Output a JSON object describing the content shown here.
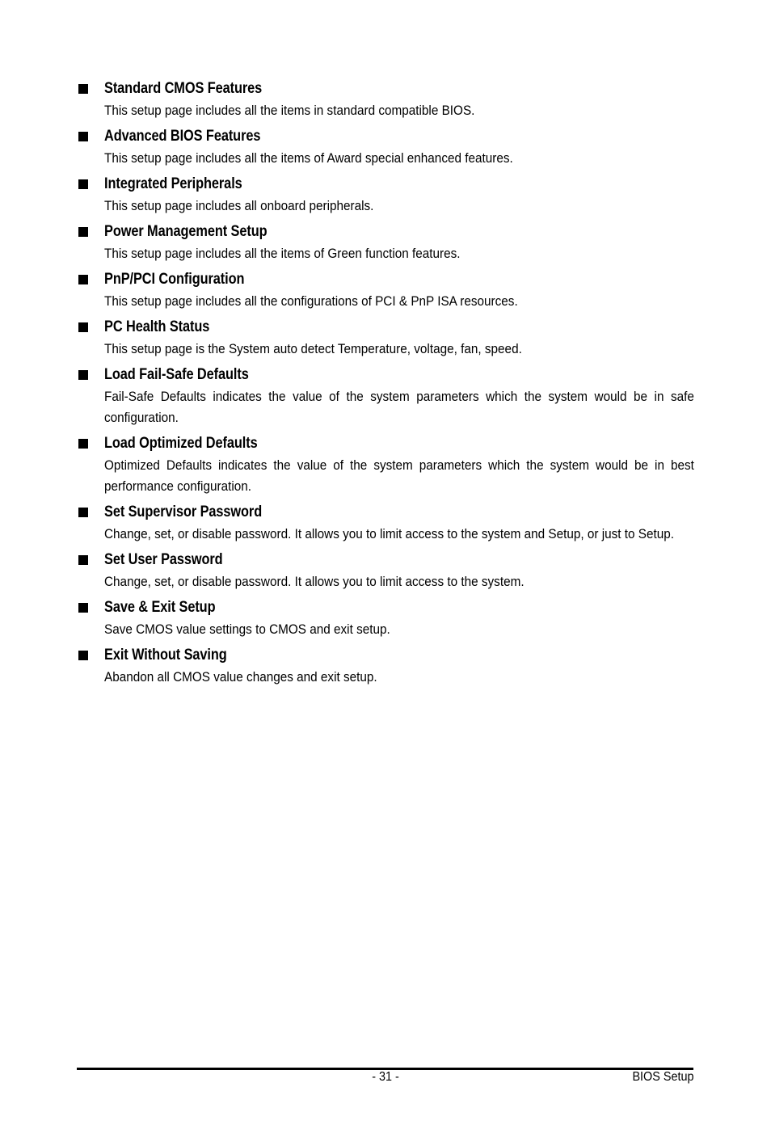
{
  "items": [
    {
      "title": "Standard CMOS Features",
      "desc": "This setup page includes all the items in standard compatible BIOS."
    },
    {
      "title": "Advanced BIOS Features",
      "desc": "This setup page includes all the items of Award special enhanced features."
    },
    {
      "title": "Integrated Peripherals",
      "desc": "This setup page includes all onboard peripherals."
    },
    {
      "title": "Power Management Setup",
      "desc": "This setup page includes all the items of Green function features."
    },
    {
      "title": "PnP/PCI Configuration",
      "desc": "This setup page includes all the configurations of PCI & PnP ISA resources."
    },
    {
      "title": "PC Health Status",
      "desc": "This setup page is the System auto detect Temperature, voltage, fan, speed."
    },
    {
      "title": "Load Fail-Safe Defaults",
      "desc": "Fail-Safe Defaults indicates the value of the system parameters which the system would be in safe configuration."
    },
    {
      "title": "Load Optimized Defaults",
      "desc": "Optimized Defaults indicates the value of the system parameters which the system would be in best performance configuration."
    },
    {
      "title": "Set Supervisor Password",
      "desc": "Change, set, or disable password. It allows you to limit access to the system and Setup, or just to Setup."
    },
    {
      "title": "Set User Password",
      "desc": "Change, set, or disable password. It allows you to limit access to the system."
    },
    {
      "title": "Save & Exit Setup",
      "desc": "Save CMOS value settings to CMOS and exit setup."
    },
    {
      "title": "Exit Without Saving",
      "desc": "Abandon all CMOS value changes and exit setup."
    }
  ],
  "footer": {
    "page_number": "- 31 -",
    "section": "BIOS Setup"
  }
}
